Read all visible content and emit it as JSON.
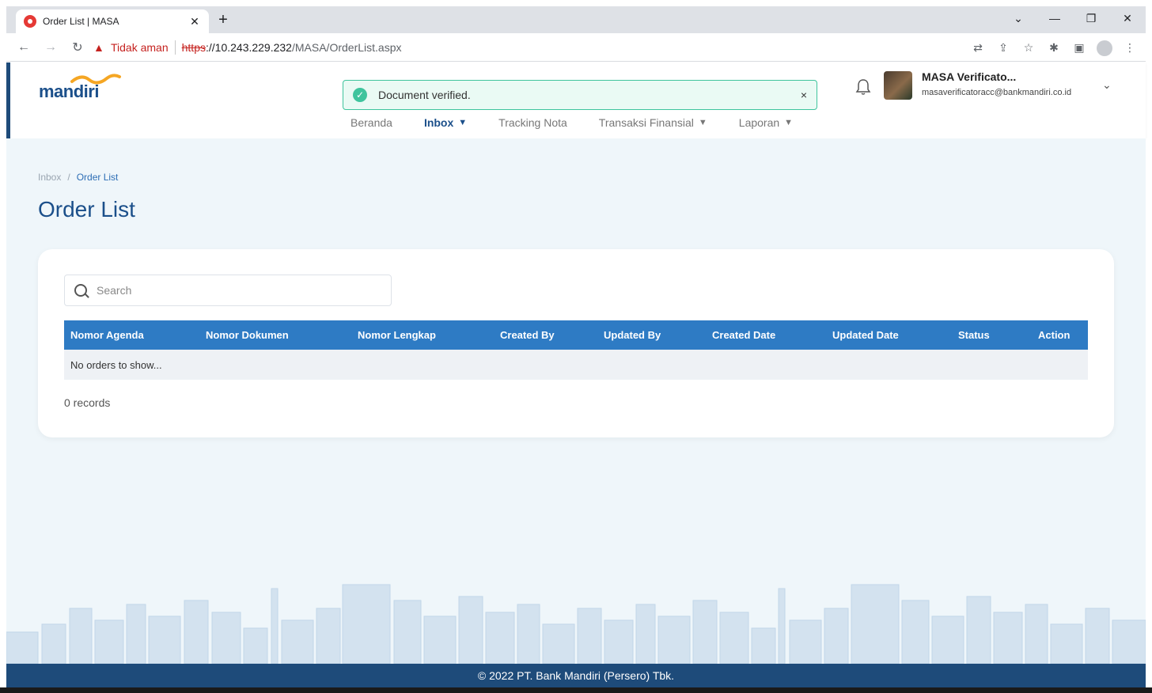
{
  "browser": {
    "tab_title": "Order List | MASA",
    "tab_close": "✕",
    "new_tab": "+",
    "security_text": "Tidak aman",
    "url_scheme": "https",
    "url_host": "://10.243.229.232",
    "url_path": "/MASA/OrderList.aspx"
  },
  "header": {
    "logo_text": "mandiri",
    "toast": {
      "text": "Document verified.",
      "close": "×"
    },
    "nav": [
      {
        "label": "Beranda"
      },
      {
        "label": "Inbox"
      },
      {
        "label": "Tracking Nota"
      },
      {
        "label": "Transaksi Finansial"
      },
      {
        "label": "Laporan"
      }
    ],
    "user": {
      "name": "MASA Verificato...",
      "email": "masaverificatoracc@bankmandiri.co.id"
    }
  },
  "breadcrumb": {
    "inbox": "Inbox",
    "separator": "/",
    "current": "Order List"
  },
  "page_title": "Order List",
  "search": {
    "placeholder": "Search"
  },
  "table": {
    "columns": [
      "Nomor Agenda",
      "Nomor Dokumen",
      "Nomor Lengkap",
      "Created By",
      "Updated By",
      "Created Date",
      "Updated Date",
      "Status",
      "Action"
    ],
    "empty_text": "No orders to show..."
  },
  "records": "0 records",
  "footer": "© 2022 PT. Bank Mandiri (Persero) Tbk.",
  "colors": {
    "brand_blue": "#1b4f8a",
    "table_header": "#2e7bc4",
    "toast_green": "#3fc49d",
    "logo_gold": "#f5a623"
  }
}
